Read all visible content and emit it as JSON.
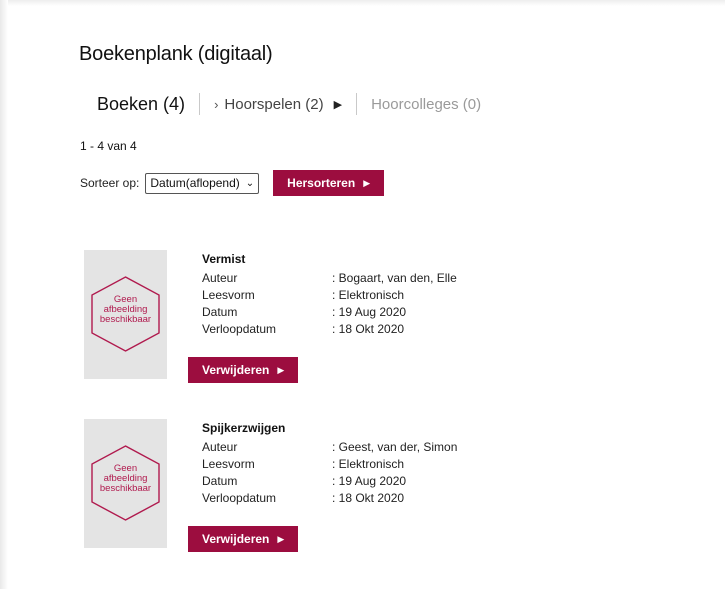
{
  "page": {
    "title": "Boekenplank (digitaal)"
  },
  "tabs": {
    "active_label": "Boeken (4)",
    "hoorspelen_label": "Hoorspelen (2)",
    "hoorcolleges_label": "Hoorcolleges (0)"
  },
  "results": {
    "count_text": "1 - 4 van 4"
  },
  "sort": {
    "label": "Sorteer op:",
    "selected": "Datum(aflopend)",
    "button_label": "Hersorteren"
  },
  "placeholder": {
    "line1": "Geen",
    "line2": "afbeelding",
    "line3": "beschikbaar"
  },
  "field_labels": {
    "author": "Auteur",
    "format": "Leesvorm",
    "date": "Datum",
    "expiry": "Verloopdatum"
  },
  "books": [
    {
      "title": "Vermist",
      "author": ": Bogaart, van den, Elle",
      "format": ": Elektronisch",
      "date": ": 19 Aug 2020",
      "expiry": ": 18 Okt 2020",
      "remove_label": "Verwijderen"
    },
    {
      "title": "Spijkerzwijgen",
      "author": ": Geest, van der, Simon",
      "format": ": Elektronisch",
      "date": ": 19 Aug 2020",
      "expiry": ": 18 Okt 2020",
      "remove_label": "Verwijderen"
    }
  ],
  "colors": {
    "accent": "#9c0d3f",
    "placeholder_pink": "#b01a4e",
    "cover_gray": "#e4e4e4"
  }
}
